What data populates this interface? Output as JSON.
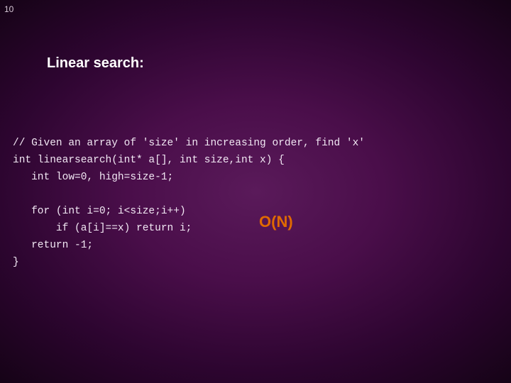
{
  "slide": {
    "number": "10",
    "title": "Linear search:"
  },
  "code": {
    "line1": "// Given an array of 'size' in increasing order, find 'x'",
    "line2": "int linearsearch(int* a[], int size,int x) {",
    "line3": "   int low=0, high=size-1;",
    "line4": "",
    "line5": "   for (int i=0; i<size;i++)",
    "line6": "       if (a[i]==x) return i;",
    "line7": "   return -1;",
    "line8": "}"
  },
  "complexity": "O(N)"
}
